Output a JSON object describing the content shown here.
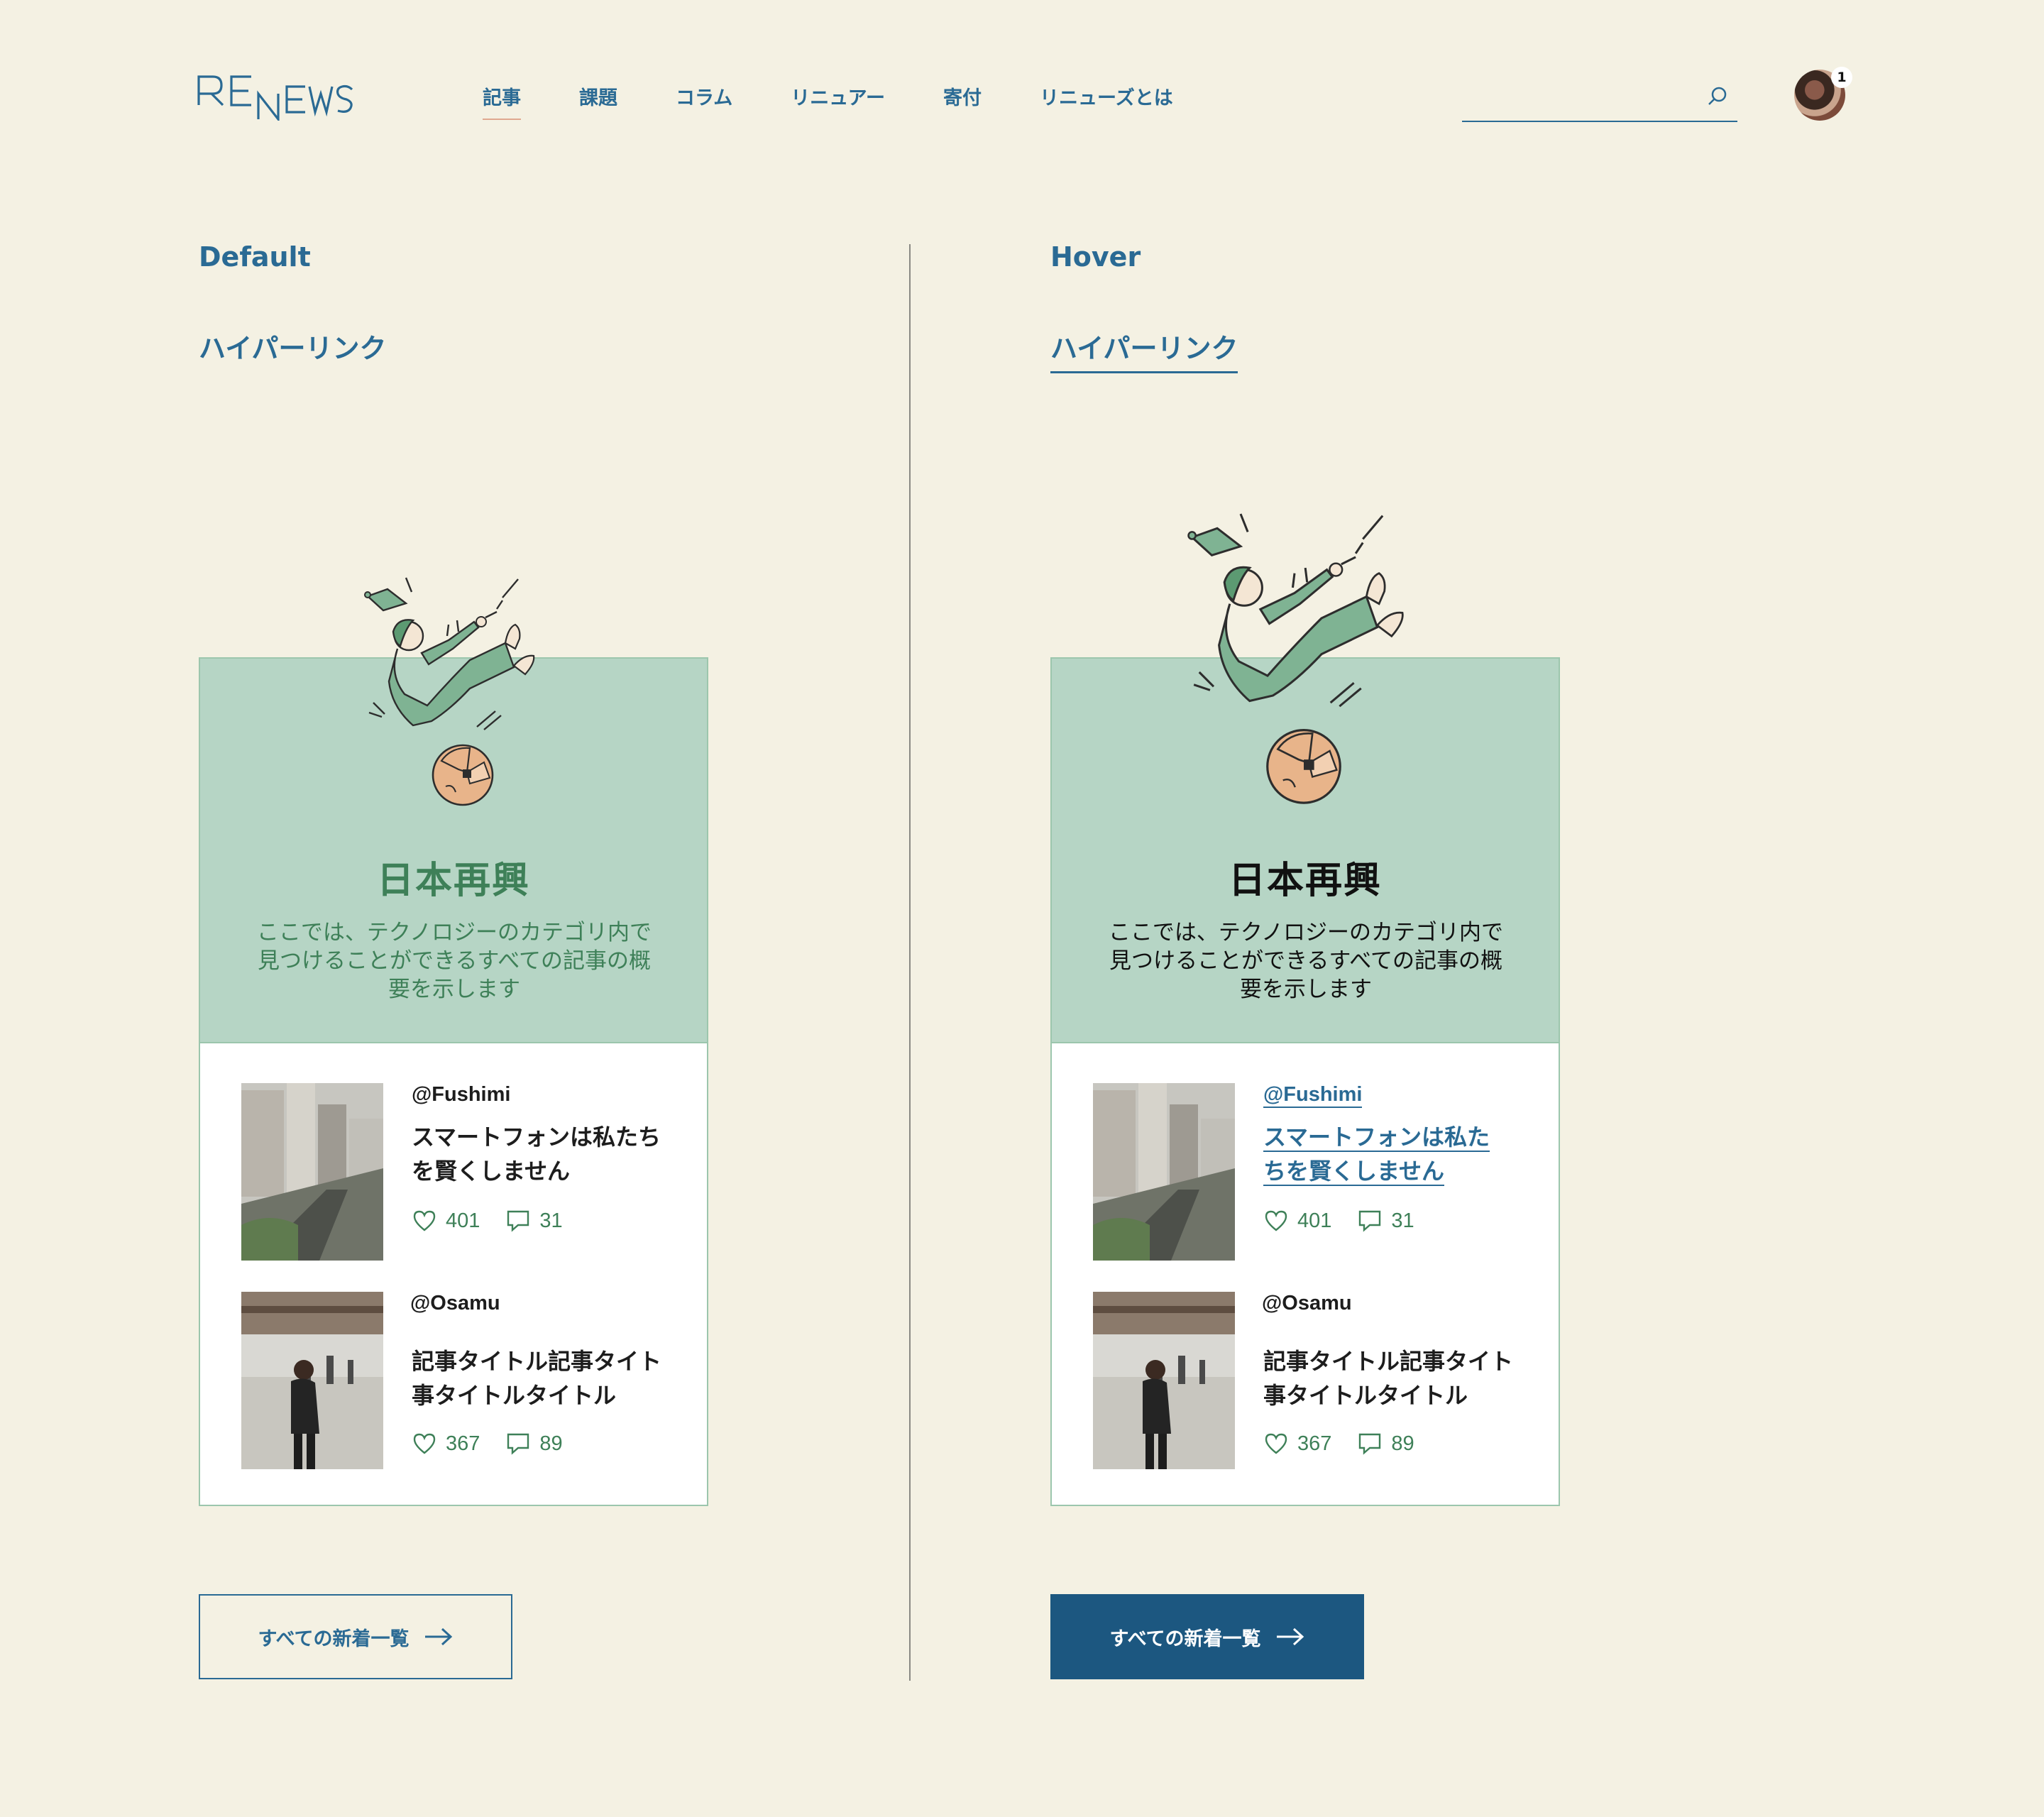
{
  "header": {
    "logo_text": "RENEWS",
    "nav": [
      {
        "label": "記事",
        "active": true
      },
      {
        "label": "課題",
        "active": false
      },
      {
        "label": "コラム",
        "active": false
      },
      {
        "label": "リニュアー",
        "active": false
      },
      {
        "label": "寄付",
        "active": false
      },
      {
        "label": "リニューズとは",
        "active": false
      }
    ],
    "search": {
      "placeholder": "",
      "value": "",
      "icon": "search-icon"
    },
    "avatar": {
      "badge": "1"
    }
  },
  "colors": {
    "background": "#f4f1e3",
    "primary_blue": "#2a6a94",
    "button_hover_blue": "#1c5780",
    "card_green": "#b6d5c5",
    "text_green": "#3e8058",
    "globe_orange": "#e8b48a"
  },
  "states": [
    {
      "label": "Default",
      "hyperlink": "ハイパーリンク",
      "card": {
        "title": "日本再興",
        "description": "ここでは、テクノロジーのカテゴリ内で見つけることができるすべての記事の概要を示します",
        "items": [
          {
            "author": "@Fushimi",
            "title": "スマートフォンは私たちを賢くしません",
            "likes": "401",
            "comments": "31"
          },
          {
            "author": "@Osamu",
            "title": "記事タイトル記事タイト事タイトルタイトル",
            "likes": "367",
            "comments": "89"
          }
        ]
      },
      "button": "すべての新着一覧"
    },
    {
      "label": "Hover",
      "hyperlink": "ハイパーリンク",
      "card": {
        "title": "日本再興",
        "description": "ここでは、テクノロジーのカテゴリ内で見つけることができるすべての記事の概要を示します",
        "items": [
          {
            "author": "@Fushimi",
            "title_lines": [
              "スマートフォンは私た",
              "ちを賢くしません"
            ],
            "likes": "401",
            "comments": "31"
          },
          {
            "author": "@Osamu",
            "title": "記事タイトル記事タイト事タイトルタイトル",
            "likes": "367",
            "comments": "89"
          }
        ]
      },
      "button": "すべての新着一覧"
    }
  ]
}
